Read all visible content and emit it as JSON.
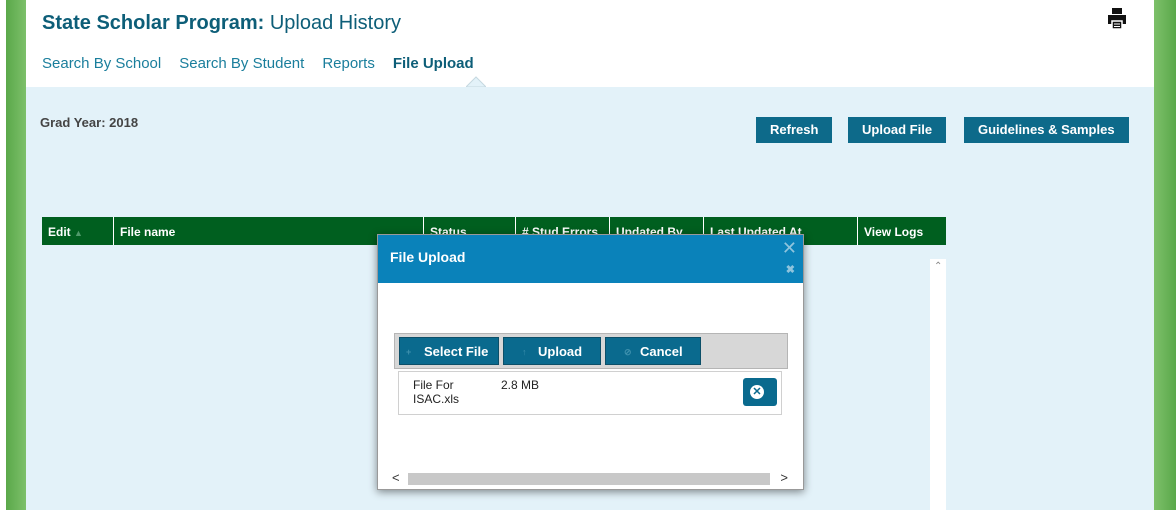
{
  "header": {
    "title_bold": "State Scholar Program:",
    "title_rest": " Upload History",
    "print_icon": "printer-icon"
  },
  "nav": {
    "items": [
      {
        "label": "Search By School",
        "active": false
      },
      {
        "label": "Search By Student",
        "active": false
      },
      {
        "label": "Reports",
        "active": false
      },
      {
        "label": "File Upload",
        "active": true
      }
    ]
  },
  "content": {
    "grad_year": "Grad Year: 2018",
    "buttons": {
      "refresh": "Refresh",
      "upload_file": "Upload File",
      "guidelines": "Guidelines & Samples"
    }
  },
  "table": {
    "columns": [
      "Edit",
      "File name",
      "Status",
      "# Stud Errors",
      "Updated By",
      "Last Updated At",
      "View Logs"
    ],
    "edit_sort_icon": "sort-arrow-icon"
  },
  "modal": {
    "title": "File Upload",
    "close_icon": "close-icon",
    "toolbar": {
      "select_file": "Select File",
      "upload": "Upload",
      "cancel": "Cancel"
    },
    "file": {
      "name": "File For ISAC.xls",
      "size": "2.8 MB"
    }
  },
  "colors": {
    "brand_blue": "#0d6a8a",
    "modal_header": "#0a82ba",
    "table_header": "#005f1f",
    "content_bg": "#e3f2f9",
    "side_green": "#6cb35c"
  }
}
